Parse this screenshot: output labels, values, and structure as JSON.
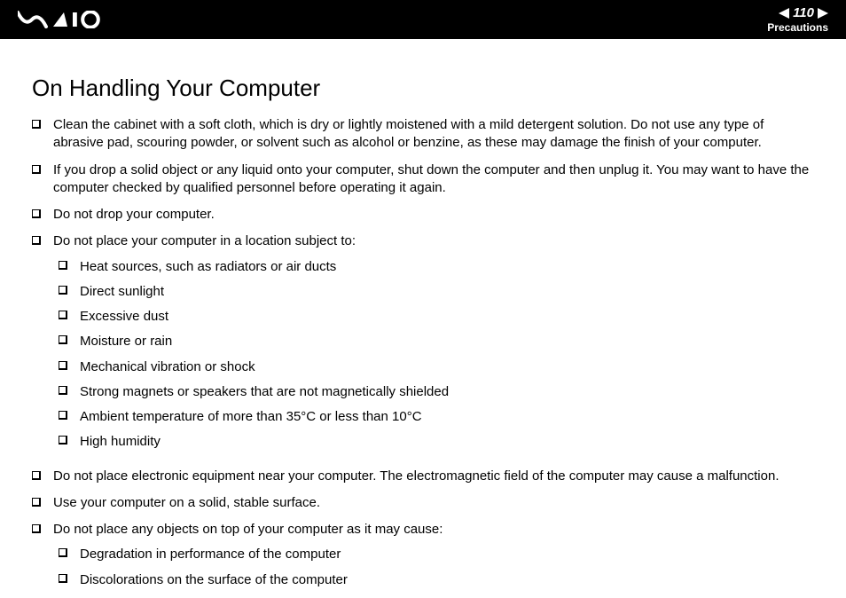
{
  "header": {
    "page_number": "110",
    "section": "Precautions"
  },
  "title": "On Handling Your Computer",
  "items": [
    {
      "text": "Clean the cabinet with a soft cloth, which is dry or lightly moistened with a mild detergent solution. Do not use any type of abrasive pad, scouring powder, or solvent such as alcohol or benzine, as these may damage the finish of your computer."
    },
    {
      "text": "If you drop a solid object or any liquid onto your computer, shut down the computer and then unplug it. You may want to have the computer checked by qualified personnel before operating it again."
    },
    {
      "text": "Do not drop your computer."
    },
    {
      "text": "Do not place your computer in a location subject to:",
      "sub": [
        "Heat sources, such as radiators or air ducts",
        "Direct sunlight",
        "Excessive dust",
        "Moisture or rain",
        "Mechanical vibration or shock",
        "Strong magnets or speakers that are not magnetically shielded",
        "Ambient temperature of more than 35°C or less than 10°C",
        "High humidity"
      ]
    },
    {
      "text": "Do not place electronic equipment near your computer. The electromagnetic field of the computer may cause a malfunction."
    },
    {
      "text": "Use your computer on a solid, stable surface."
    },
    {
      "text": "Do not place any objects on top of your computer as it may cause:",
      "sub": [
        "Degradation in performance of the computer",
        "Discolorations on the surface of the computer"
      ]
    }
  ]
}
